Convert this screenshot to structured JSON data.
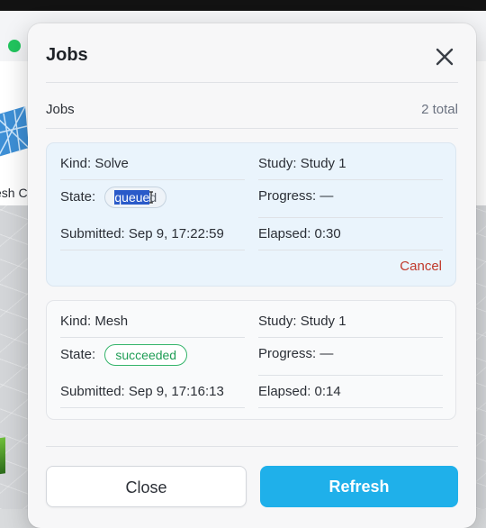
{
  "background": {
    "thumb_label": "esh C"
  },
  "dialog": {
    "title": "Jobs",
    "close_icon": "close-icon",
    "section_label": "Jobs",
    "total": "2 total"
  },
  "jobs": [
    {
      "kind_key": "Kind:",
      "kind": "Solve",
      "study_key": "Study:",
      "study": "Study 1",
      "state_key": "State:",
      "state_selected": "queue",
      "state_rest": "d",
      "progress_key": "Progress:",
      "progress": "—",
      "submitted_key": "Submitted:",
      "submitted": "Sep 9, 17:22:59",
      "elapsed_key": "Elapsed:",
      "elapsed": "0:30",
      "cancel_label": "Cancel"
    },
    {
      "kind_key": "Kind:",
      "kind": "Mesh",
      "study_key": "Study:",
      "study": "Study 1",
      "state_key": "State:",
      "state": "succeeded",
      "progress_key": "Progress:",
      "progress": "—",
      "submitted_key": "Submitted:",
      "submitted": "Sep 9, 17:16:13",
      "elapsed_key": "Elapsed:",
      "elapsed": "0:14"
    }
  ],
  "footer": {
    "close_label": "Close",
    "refresh_label": "Refresh"
  },
  "colors": {
    "primary": "#1fb0ea",
    "danger": "#c0392b",
    "success": "#1f9d55",
    "selection": "#2a5ac9"
  }
}
